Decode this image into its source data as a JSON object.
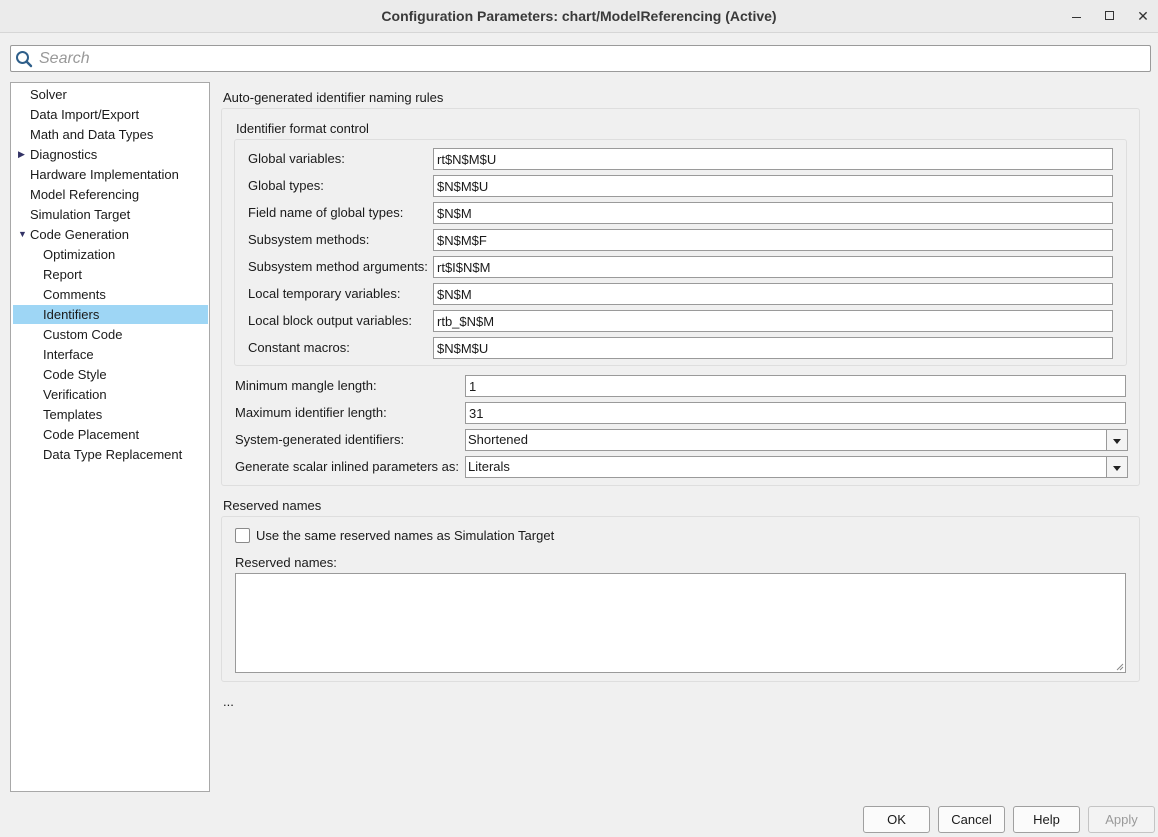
{
  "window": {
    "title": "Configuration Parameters: chart/ModelReferencing (Active)"
  },
  "search": {
    "placeholder": "Search"
  },
  "tree": {
    "items": [
      {
        "label": "Solver"
      },
      {
        "label": "Data Import/Export"
      },
      {
        "label": "Math and Data Types"
      },
      {
        "label": "Diagnostics"
      },
      {
        "label": "Hardware Implementation"
      },
      {
        "label": "Model Referencing"
      },
      {
        "label": "Simulation Target"
      },
      {
        "label": "Code Generation"
      },
      {
        "label": "Optimization"
      },
      {
        "label": "Report"
      },
      {
        "label": "Comments"
      },
      {
        "label": "Identifiers"
      },
      {
        "label": "Custom Code"
      },
      {
        "label": "Interface"
      },
      {
        "label": "Code Style"
      },
      {
        "label": "Verification"
      },
      {
        "label": "Templates"
      },
      {
        "label": "Code Placement"
      },
      {
        "label": "Data Type Replacement"
      }
    ],
    "expand_icons": [
      "collapsed-arrow-icon",
      "expanded-arrow-icon"
    ],
    "selected": "Identifiers"
  },
  "naming": {
    "section_title": "Auto-generated identifier naming rules",
    "format_group_title": "Identifier format control",
    "fields": [
      {
        "label": "Global variables:",
        "value": "rt$N$M$U"
      },
      {
        "label": "Global types:",
        "value": "$N$M$U"
      },
      {
        "label": "Field name of global types:",
        "value": "$N$M"
      },
      {
        "label": "Subsystem methods:",
        "value": "$N$M$F"
      },
      {
        "label": "Subsystem method arguments:",
        "value": "rt$I$N$M"
      },
      {
        "label": "Local temporary variables:",
        "value": "$N$M"
      },
      {
        "label": "Local block output variables:",
        "value": "rtb_$N$M"
      },
      {
        "label": "Constant macros:",
        "value": "$N$M$U"
      }
    ],
    "min_mangle_label": "Minimum mangle length:",
    "min_mangle_value": "1",
    "max_id_label": "Maximum identifier length:",
    "max_id_value": "31",
    "sysgen_label": "System-generated identifiers:",
    "sysgen_value": "Shortened",
    "scalar_label": "Generate scalar inlined parameters as:",
    "scalar_value": "Literals"
  },
  "reserved": {
    "section_title": "Reserved names",
    "checkbox_label": "Use the same reserved names as Simulation Target",
    "checkbox_checked": false,
    "names_label": "Reserved names:",
    "names_value": ""
  },
  "ellipsis": "...",
  "buttons": {
    "ok": "OK",
    "cancel": "Cancel",
    "help": "Help",
    "apply": "Apply"
  },
  "colors": {
    "selection": "#9ed6f5",
    "background": "#f0f0f0"
  }
}
